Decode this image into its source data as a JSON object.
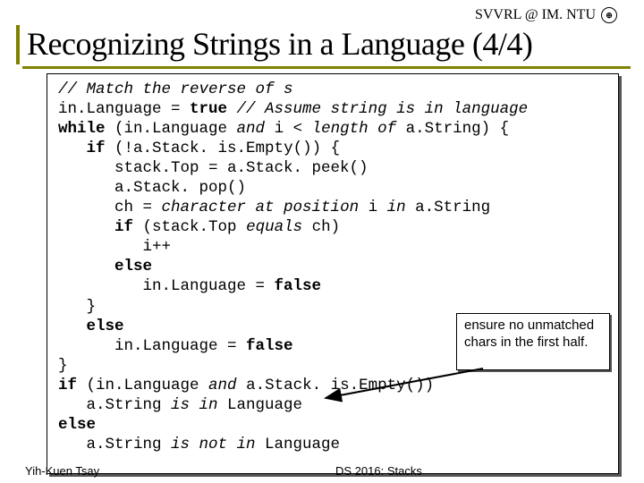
{
  "header": {
    "org": "SVVRL @ IM. NTU",
    "logo_glyph": "⊕"
  },
  "title": "Recognizing Strings in a Language (4/4)",
  "code": {
    "l1_a": "// Match the reverse of s",
    "l2_a": "in.Language = ",
    "l2_b": "true",
    "l2_c": " // Assume string is in language",
    "l3_a": "while",
    "l3_b": " (in.Language ",
    "l3_c": "and",
    "l3_d": " i < ",
    "l3_e": "length of",
    "l3_f": " a.String) {",
    "l4_a": "   ",
    "l4_b": "if",
    "l4_c": " (!a.Stack. is.Empty()) {",
    "l5": "      stack.Top = a.Stack. peek()",
    "l6": "      a.Stack. pop()",
    "l7_a": "      ch = ",
    "l7_b": "character at position",
    "l7_c": " i ",
    "l7_d": "in",
    "l7_e": " a.String",
    "l8_a": "      ",
    "l8_b": "if",
    "l8_c": " (stack.Top ",
    "l8_d": "equals",
    "l8_e": " ch)",
    "l9": "         i++",
    "l10_a": "      ",
    "l10_b": "else",
    "l11_a": "         in.Language = ",
    "l11_b": "false",
    "l12": "   }",
    "l13_a": "   ",
    "l13_b": "else",
    "l14_a": "      in.Language = ",
    "l14_b": "false",
    "l15": "}",
    "l16_a": "if",
    "l16_b": " (in.Language ",
    "l16_c": "and",
    "l16_d": " a.Stack. is.Empty())",
    "l17_a": "   a.String ",
    "l17_b": "is in",
    "l17_c": " Language",
    "l18_a": "else",
    "l19_a": "   a.String ",
    "l19_b": "is not in",
    "l19_c": " Language"
  },
  "note": "ensure no unmatched chars in the first half.",
  "footer": {
    "author": "Yih-Kuen Tsay",
    "course": "DS 2016: Stacks"
  }
}
